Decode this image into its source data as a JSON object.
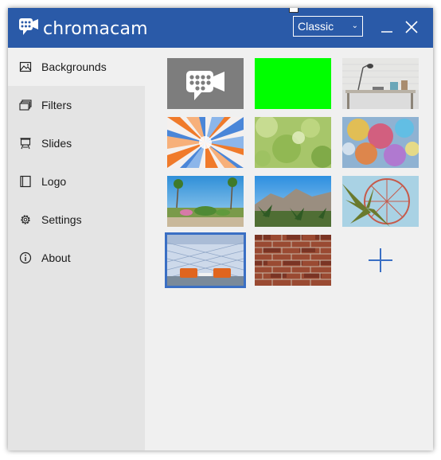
{
  "app": {
    "name": "chromacam",
    "brand_color": "#2a5aa8",
    "logo_icon": "chromacam-logo-icon"
  },
  "header": {
    "mode_select": {
      "value": "Classic"
    },
    "minimize_icon": "minimize-icon",
    "close_icon": "close-icon"
  },
  "sidebar": {
    "items": [
      {
        "label": "Backgrounds",
        "icon": "image-icon",
        "active": true
      },
      {
        "label": "Filters",
        "icon": "layers-icon",
        "active": false
      },
      {
        "label": "Slides",
        "icon": "easel-icon",
        "active": false
      },
      {
        "label": "Logo",
        "icon": "logo-frame-icon",
        "active": false
      },
      {
        "label": "Settings",
        "icon": "gear-icon",
        "active": false
      },
      {
        "label": "About",
        "icon": "info-icon",
        "active": false
      }
    ]
  },
  "backgrounds": {
    "items": [
      {
        "kind": "chromacam-logo",
        "selected": false
      },
      {
        "kind": "green-screen",
        "color": "#00ff00",
        "selected": false
      },
      {
        "kind": "desk-with-lamp",
        "selected": false
      },
      {
        "kind": "sunburst-rays",
        "selected": false
      },
      {
        "kind": "green-bokeh",
        "selected": false
      },
      {
        "kind": "colorful-bokeh",
        "selected": false
      },
      {
        "kind": "palm-garden",
        "selected": false
      },
      {
        "kind": "desert-mountains",
        "selected": false
      },
      {
        "kind": "palm-ferris-wheel",
        "selected": false
      },
      {
        "kind": "modern-room-orange-sofas",
        "selected": true
      },
      {
        "kind": "brick-wall",
        "selected": false
      }
    ],
    "add_icon": "plus-icon",
    "accent_color": "#3a6fc4"
  }
}
